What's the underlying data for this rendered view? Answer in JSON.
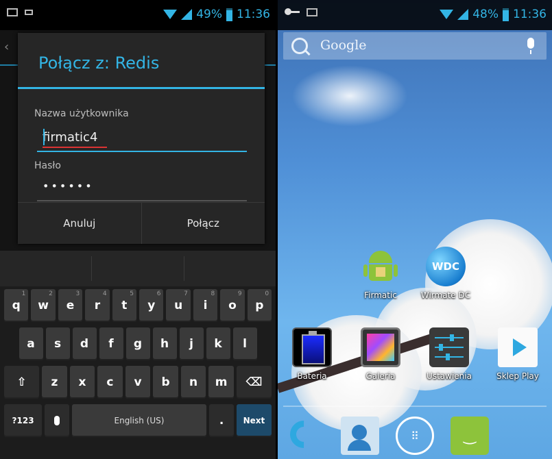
{
  "left": {
    "status": {
      "battery": "49%",
      "time": "11:36"
    },
    "dialog": {
      "title": "Połącz z: Redis",
      "username_label": "Nazwa użytkownika",
      "username_value": "firmatic4",
      "password_label": "Hasło",
      "password_value": "••••••",
      "cancel": "Anuluj",
      "connect": "Połącz"
    },
    "keyboard": {
      "row1": [
        {
          "k": "q",
          "h": "1"
        },
        {
          "k": "w",
          "h": "2"
        },
        {
          "k": "e",
          "h": "3"
        },
        {
          "k": "r",
          "h": "4"
        },
        {
          "k": "t",
          "h": "5"
        },
        {
          "k": "y",
          "h": "6"
        },
        {
          "k": "u",
          "h": "7"
        },
        {
          "k": "i",
          "h": "8"
        },
        {
          "k": "o",
          "h": "9"
        },
        {
          "k": "p",
          "h": "0"
        }
      ],
      "row2": [
        "a",
        "s",
        "d",
        "f",
        "g",
        "h",
        "j",
        "k",
        "l"
      ],
      "row3": [
        "z",
        "x",
        "c",
        "v",
        "b",
        "n",
        "m"
      ],
      "shift": "⇧",
      "backspace": "⌫",
      "symbols": "?123",
      "space": "English (US)",
      "period": ".",
      "next": "Next"
    }
  },
  "right": {
    "status": {
      "battery": "48%",
      "time": "11:36"
    },
    "search": {
      "placeholder": "Google"
    },
    "apps_row1": [
      {
        "label": "Firmatic",
        "icon": "android-icon"
      },
      {
        "label": "Wirmate DC",
        "icon": "wdc-globe-icon",
        "badge": "WDC"
      }
    ],
    "apps_row2": [
      {
        "label": "Bateria",
        "icon": "battery-app-icon"
      },
      {
        "label": "Galeria",
        "icon": "gallery-icon"
      },
      {
        "label": "Ustawienia",
        "icon": "settings-sliders-icon"
      },
      {
        "label": "Sklep Play",
        "icon": "play-store-icon"
      }
    ],
    "dock": [
      "phone-icon",
      "contacts-icon",
      "app-drawer-icon",
      "messaging-icon"
    ]
  },
  "colors": {
    "accent": "#33b5e5",
    "dialog_bg": "#262626",
    "key_bg": "#3a3a3a"
  }
}
